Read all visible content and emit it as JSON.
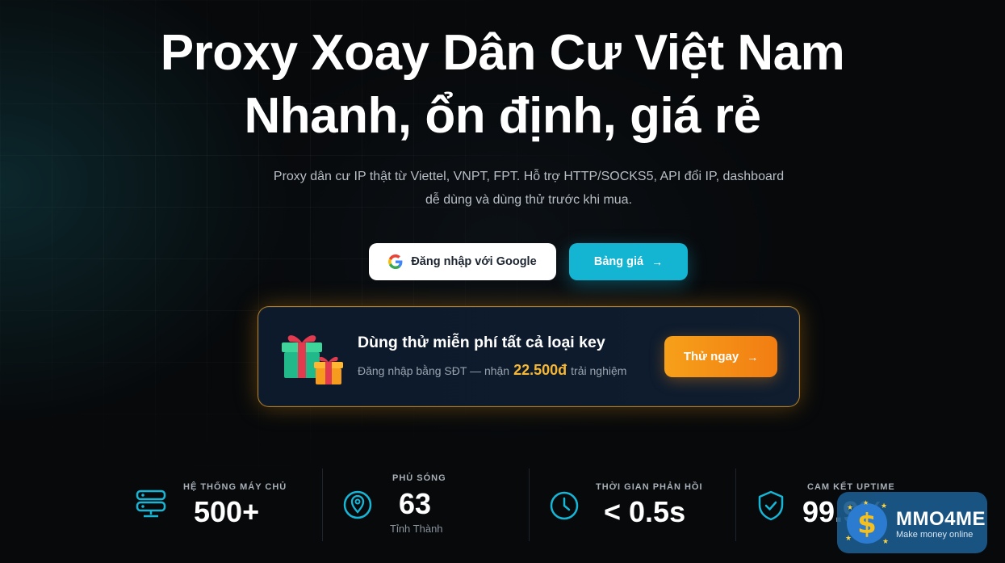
{
  "hero": {
    "title_line1": "Proxy Xoay Dân Cư Việt Nam",
    "title_line2": "Nhanh, ổn định, giá rẻ",
    "subtitle_line1": "Proxy dân cư IP thật từ Viettel, VNPT, FPT. Hỗ trợ HTTP/SOCKS5, API đổi IP, dashboard",
    "subtitle_line2": "dễ dùng và dùng thử trước khi mua."
  },
  "buttons": {
    "google_login": "Đăng nhập với Google",
    "pricing": "Bảng giá",
    "arrow": "→"
  },
  "promo": {
    "title": "Dùng thử miễn phí tất cả loại key",
    "sub_before": "Đăng nhập bằng SĐT — nhận",
    "amount": "22.500đ",
    "sub_after": "trải nghiệm",
    "cta": "Thử ngay"
  },
  "stats": [
    {
      "label": "HỆ THỐNG MÁY CHỦ",
      "value": "500+",
      "caption": "",
      "icon": "server-icon"
    },
    {
      "label": "PHỦ SÓNG",
      "value": "63",
      "caption": "Tỉnh Thành",
      "icon": "map-pin-icon"
    },
    {
      "label": "THỜI GIAN PHẢN HỒI",
      "value": "< 0.5s",
      "caption": "",
      "icon": "clock-icon"
    },
    {
      "label": "CAM KẾT UPTIME",
      "value": "99.9%",
      "caption": "",
      "icon": "shield-check-icon"
    }
  ],
  "watermark": {
    "title": "MMO4ME",
    "subtitle": "Make money online"
  },
  "colors": {
    "accent_cyan": "#14b4d3",
    "accent_orange": "#f6a01a",
    "amount_gold": "#f7b733",
    "background": "#07090b"
  }
}
